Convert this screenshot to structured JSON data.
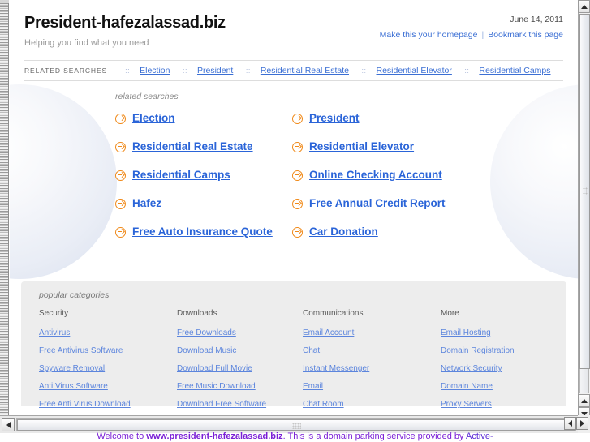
{
  "header": {
    "site_title": "President-hafezalassad.biz",
    "tagline": "Helping you find what you need",
    "date": "June 14, 2011",
    "homepage_link": "Make this your homepage",
    "link_separator": "|",
    "bookmark_link": "Bookmark this page"
  },
  "related_strip": {
    "label": "RELATED SEARCHES",
    "separator": "::",
    "items": [
      "Election",
      "President",
      "Residential Real Estate",
      "Residential Elevator",
      "Residential Camps"
    ]
  },
  "main": {
    "caption": "related searches",
    "links": [
      "Election",
      "President",
      "Residential Real Estate",
      "Residential Elevator",
      "Residential Camps",
      "Online Checking Account",
      "Hafez",
      "Free Annual Credit Report",
      "Free Auto Insurance Quote",
      "Car Donation"
    ]
  },
  "categories": {
    "caption": "popular categories",
    "columns": [
      {
        "heading": "Security",
        "links": [
          "Antivirus",
          "Free Antivirus Software",
          "Spyware Removal",
          "Anti Virus Software",
          "Free Anti Virus Download"
        ]
      },
      {
        "heading": "Downloads",
        "links": [
          "Free Downloads",
          "Download Music",
          "Download Full Movie",
          "Free Music Download",
          "Download Free Software"
        ]
      },
      {
        "heading": "Communications",
        "links": [
          "Email Account",
          "Chat",
          "Instant Messenger",
          "Email",
          "Chat Room"
        ]
      },
      {
        "heading": "More",
        "links": [
          "Email Hosting",
          "Domain Registration",
          "Network Security",
          "Domain Name",
          "Proxy Servers"
        ]
      }
    ]
  },
  "footer": {
    "welcome_prefix": "Welcome to ",
    "domain": "www.president-hafezalassad.biz",
    "welcome_middle": ". This is a domain parking service provided by ",
    "provider_link": "Active-"
  },
  "colors": {
    "link_blue": "#2a64d8",
    "small_link_blue": "#5c85dd",
    "arrow_orange": "#f08a1a",
    "category_bg": "#ededed",
    "footer_purple": "#7a1fd6"
  }
}
